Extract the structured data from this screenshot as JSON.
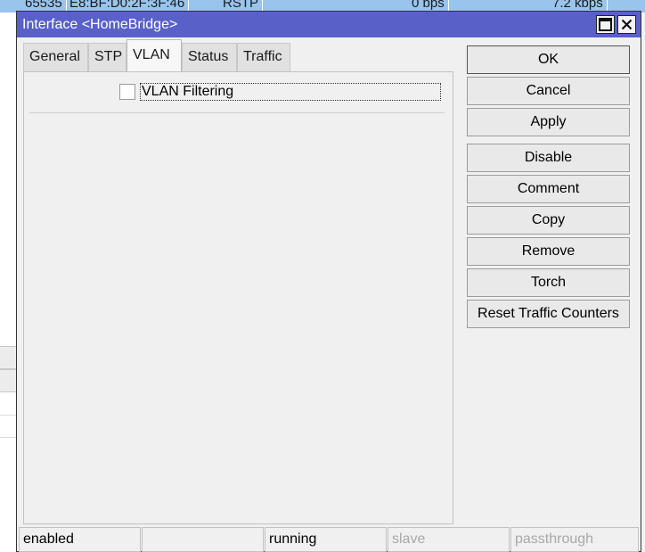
{
  "background": {
    "row_cells": [
      "65535",
      "E8:BF:D0:2F:3F:46",
      "RSTP",
      "0 bps",
      "7.2 kbps"
    ]
  },
  "window": {
    "title": "Interface <HomeBridge>",
    "maximize_icon": "maximize-icon",
    "close_icon": "close-icon",
    "titlebar_color": "#5961c8"
  },
  "tabs": [
    {
      "label": "General",
      "active": false
    },
    {
      "label": "STP",
      "active": false
    },
    {
      "label": "VLAN",
      "active": true
    },
    {
      "label": "Status",
      "active": false
    },
    {
      "label": "Traffic",
      "active": false
    }
  ],
  "vlan": {
    "vlan_filtering_label": "VLAN Filtering",
    "vlan_filtering_checked": false
  },
  "buttons": {
    "ok": "OK",
    "cancel": "Cancel",
    "apply": "Apply",
    "disable": "Disable",
    "comment": "Comment",
    "copy": "Copy",
    "remove": "Remove",
    "torch": "Torch",
    "reset_traffic_counters": "Reset Traffic Counters"
  },
  "status_bar": {
    "enabled": "enabled",
    "empty": "",
    "running": "running",
    "slave": "slave",
    "passthrough": "passthrough"
  }
}
